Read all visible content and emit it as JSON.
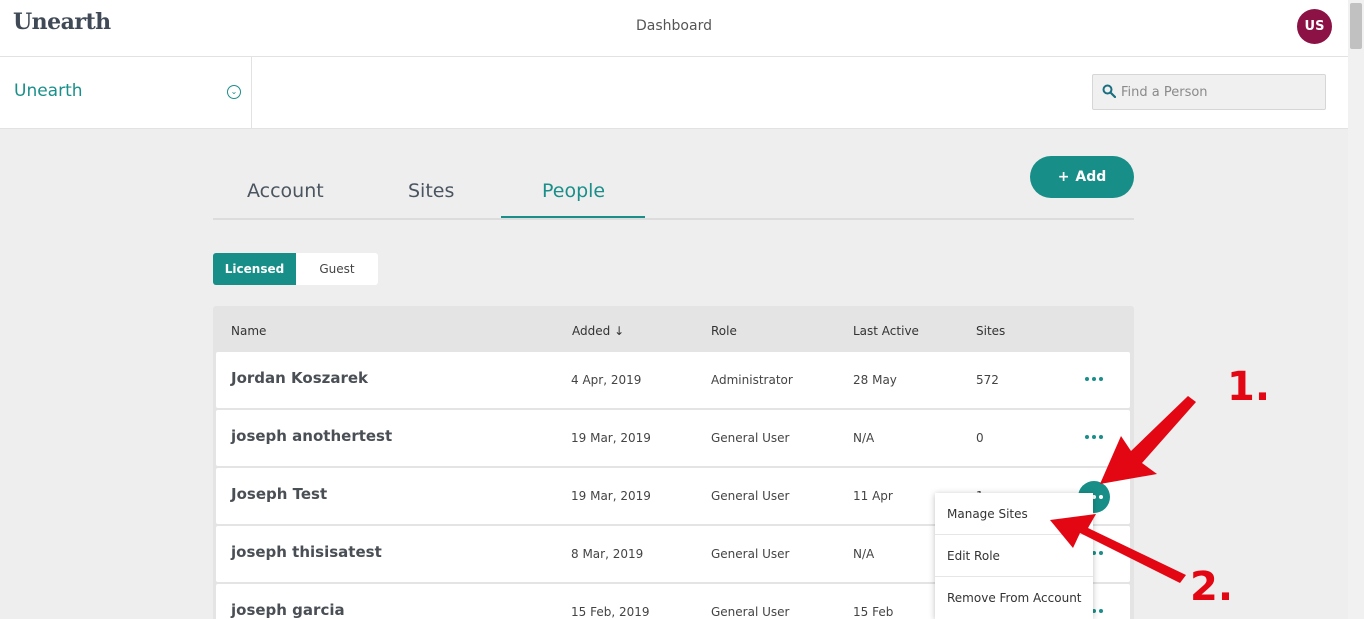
{
  "app": {
    "logo": "Unearth",
    "nav_title": "Dashboard",
    "avatar_initials": "US",
    "accent_color": "#178f88",
    "avatar_color": "#8c1246"
  },
  "subbar": {
    "account_name": "Unearth",
    "search_placeholder": "Find a Person"
  },
  "tabs": [
    {
      "label": "Account",
      "active": false
    },
    {
      "label": "Sites",
      "active": false
    },
    {
      "label": "People",
      "active": true
    }
  ],
  "add_button": {
    "label": "Add",
    "icon": "plus-icon"
  },
  "segment": {
    "licensed": "Licensed",
    "guest": "Guest"
  },
  "table": {
    "headers": {
      "name": "Name",
      "added": "Added",
      "role": "Role",
      "last_active": "Last Active",
      "sites": "Sites"
    },
    "sort_indicator": "↓",
    "rows": [
      {
        "name": "Jordan Koszarek",
        "added": "4 Apr, 2019",
        "role": "Administrator",
        "last_active": "28 May",
        "sites": "572"
      },
      {
        "name": "joseph anothertest",
        "added": "19 Mar, 2019",
        "role": "General User",
        "last_active": "N/A",
        "sites": "0"
      },
      {
        "name": "Joseph Test",
        "added": "19 Mar, 2019",
        "role": "General User",
        "last_active": "11 Apr",
        "sites": "1"
      },
      {
        "name": "joseph thisisatest",
        "added": "8 Mar, 2019",
        "role": "General User",
        "last_active": "N/A",
        "sites": ""
      },
      {
        "name": "joseph garcia",
        "added": "15 Feb, 2019",
        "role": "General User",
        "last_active": "15 Feb",
        "sites": ""
      }
    ]
  },
  "row_menu": {
    "items": [
      "Manage Sites",
      "Edit Role",
      "Remove From Account"
    ]
  },
  "annotations": {
    "step1": "1.",
    "step2": "2.",
    "color": "#e30613"
  }
}
